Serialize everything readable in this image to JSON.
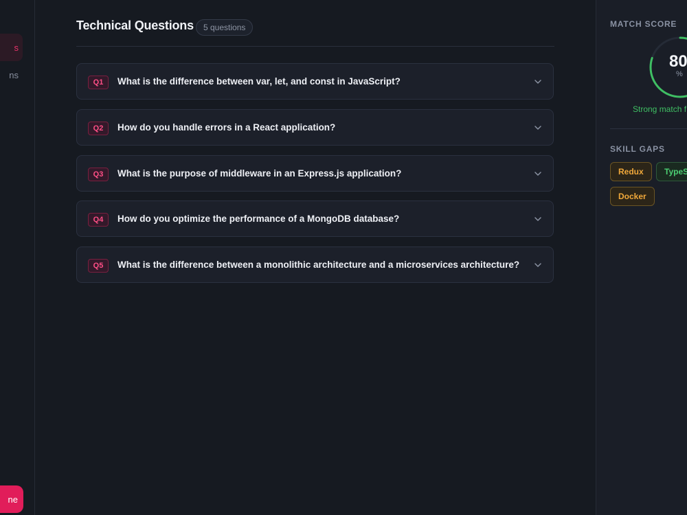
{
  "sidebar": {
    "nav_active_fragment": "s",
    "nav_inactive_fragment": "ns",
    "cta_fragment": "ne"
  },
  "section": {
    "title": "Technical Questions",
    "count": "5 questions"
  },
  "questions": [
    {
      "tag": "Q1",
      "text": "What is the difference between var, let, and const in JavaScript?"
    },
    {
      "tag": "Q2",
      "text": "How do you handle errors in a React application?"
    },
    {
      "tag": "Q3",
      "text": "What is the purpose of middleware in an Express.js application?"
    },
    {
      "tag": "Q4",
      "text": "How do you optimize the performance of a MongoDB database?"
    },
    {
      "tag": "Q5",
      "text": "What is the difference between a monolithic architecture and a microservices architecture?"
    }
  ],
  "match": {
    "label": "MATCH SCORE",
    "value": "80",
    "unit": "%",
    "note": "Strong match f",
    "percent": 80,
    "ring_color": "#3fbf63"
  },
  "skill_gaps": {
    "label": "SKILL GAPS",
    "chips": [
      "Redux",
      "TypeS",
      "Docker"
    ]
  },
  "colors": {
    "accent": "#e11d5a",
    "warning": "#f0a83a",
    "success": "#4ccf73"
  }
}
